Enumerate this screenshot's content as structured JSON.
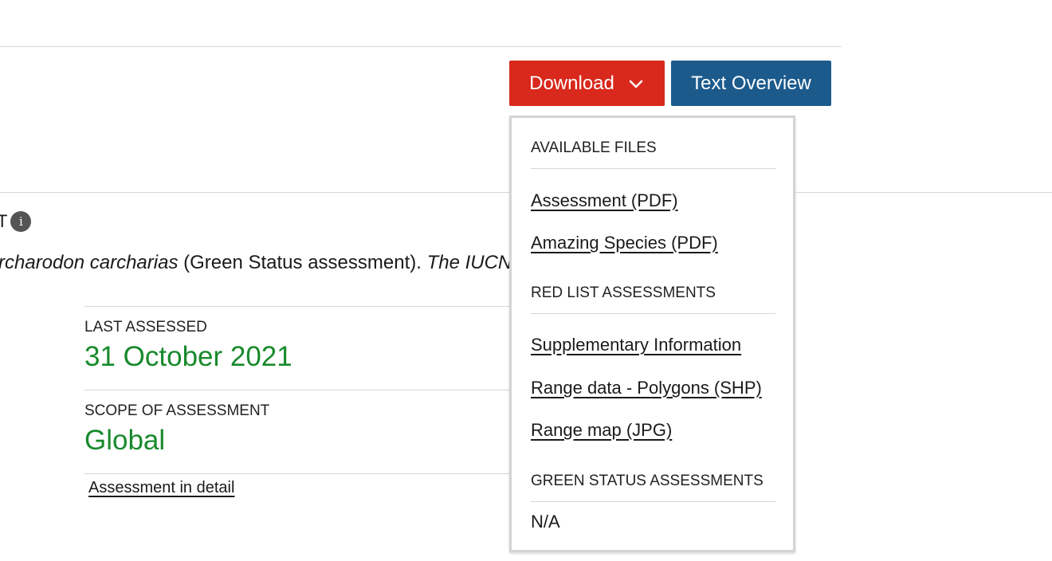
{
  "toolbar": {
    "download_label": "Download",
    "text_overview_label": "Text Overview",
    "chevron_icon": "chevron-down-icon",
    "colors": {
      "download_bg": "#d8291c",
      "overview_bg": "#1c5a8c"
    }
  },
  "citation": {
    "heading_visible_fragment": "T",
    "info_icon": "info-icon",
    "info_glyph": "i",
    "species_fragment": "rcharodon carcharias",
    "status_text": " (Green Status assessment). ",
    "journal_fragment": "The IUCN"
  },
  "assessment": {
    "last_assessed_label": "LAST ASSESSED",
    "last_assessed_value": "31 October 2021",
    "scope_label": "SCOPE OF ASSESSMENT",
    "scope_value": "Global",
    "detail_link": "Assessment in detail",
    "value_color": "#188a2c"
  },
  "download_menu": {
    "available_files": {
      "heading": "AVAILABLE FILES",
      "items": [
        "Assessment (PDF)",
        "Amazing Species (PDF)"
      ]
    },
    "red_list": {
      "heading": "RED LIST ASSESSMENTS",
      "items": [
        "Supplementary Information",
        "Range data - Polygons (SHP)",
        "Range map (JPG)"
      ]
    },
    "green_status": {
      "heading": "GREEN STATUS ASSESSMENTS",
      "value": "N/A"
    }
  }
}
